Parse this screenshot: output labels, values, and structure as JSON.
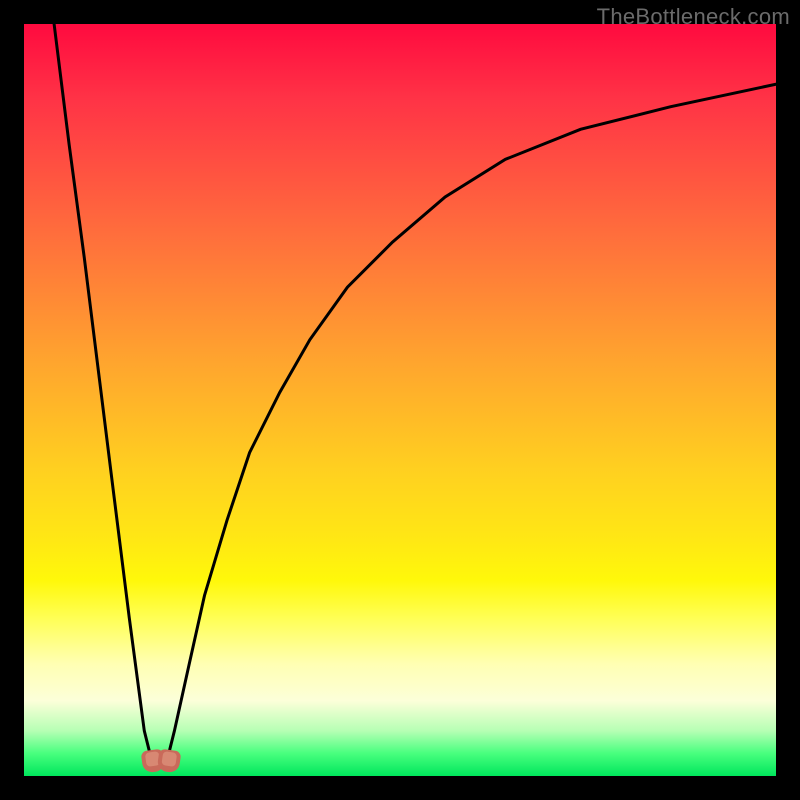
{
  "watermark": "TheBottleneck.com",
  "chart_data": {
    "type": "line",
    "title": "",
    "xlabel": "",
    "ylabel": "",
    "xlim": [
      0,
      100
    ],
    "ylim": [
      0,
      100
    ],
    "grid": false,
    "legend": false,
    "series": [
      {
        "name": "left-branch",
        "x": [
          4,
          6,
          8,
          10,
          12,
          14,
          16,
          17
        ],
        "values": [
          100,
          84,
          69,
          53,
          37,
          21,
          6,
          2
        ]
      },
      {
        "name": "right-branch",
        "x": [
          19,
          20,
          22,
          24,
          27,
          30,
          34,
          38,
          43,
          49,
          56,
          64,
          74,
          86,
          100
        ],
        "values": [
          2,
          6,
          15,
          24,
          34,
          43,
          51,
          58,
          65,
          71,
          77,
          82,
          86,
          89,
          92
        ]
      }
    ],
    "annotations": [
      {
        "name": "cusp-marker",
        "x": 18,
        "y": 1
      }
    ],
    "gradient_stops": [
      {
        "pos": 0,
        "color": "#ff0a3f"
      },
      {
        "pos": 28,
        "color": "#ff6e3c"
      },
      {
        "pos": 60,
        "color": "#ffd21f"
      },
      {
        "pos": 85,
        "color": "#ffffb2"
      },
      {
        "pos": 100,
        "color": "#00e65c"
      }
    ]
  }
}
